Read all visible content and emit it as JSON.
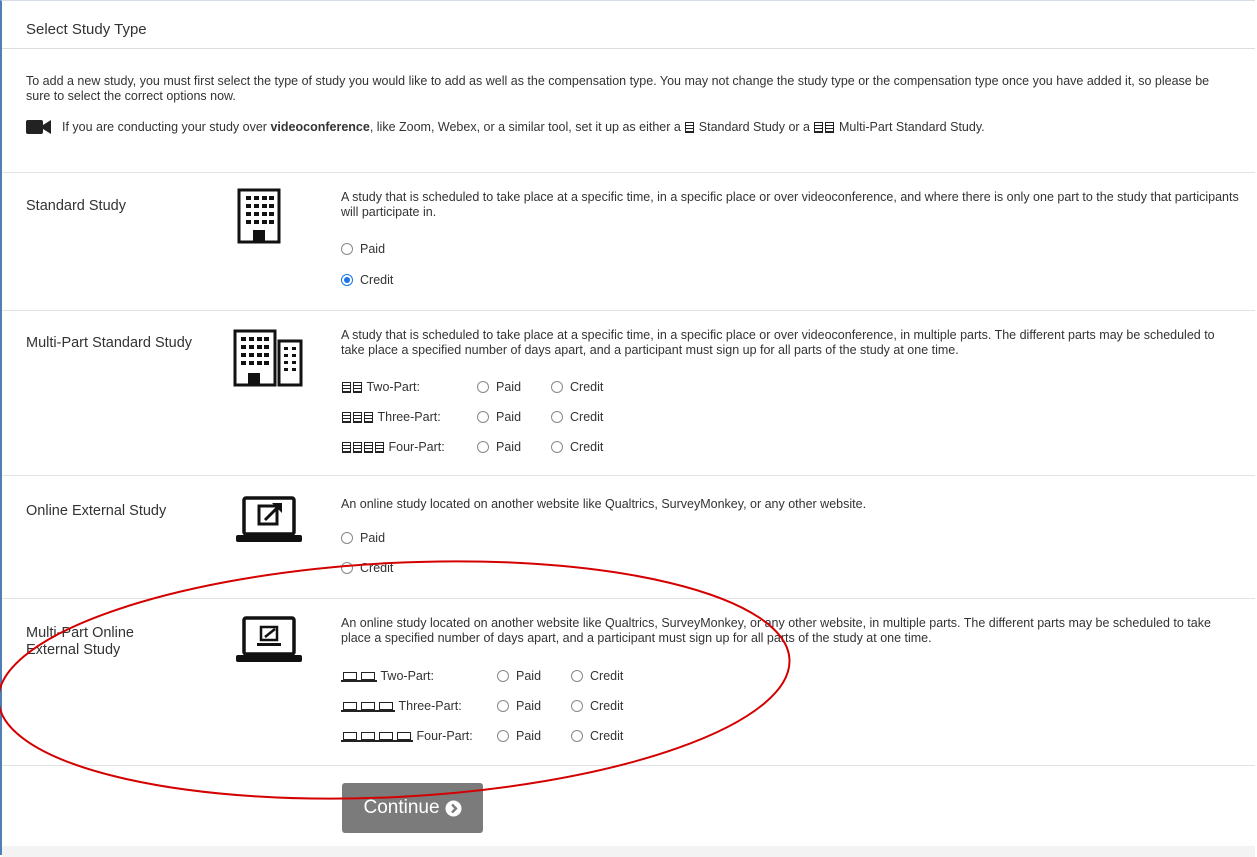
{
  "panel": {
    "title": "Select Study Type",
    "intro": "To add a new study, you must first select the type of study you would like to add as well as the compensation type. You may not change the study type or the compensation type once you have added it, so please be sure to select the correct options now.",
    "video_prefix": "If you are conducting your study over",
    "video_bold": "videoconference",
    "video_mid": ", like Zoom, Webex, or a similar tool, set it up as either a",
    "video_standard": "Standard Study or a",
    "video_multi": "Multi-Part Standard Study."
  },
  "studies": [
    {
      "name": "Standard Study",
      "icon": "building-icon",
      "description": "A study that is scheduled to take place at a specific time, in a specific place or over videoconference, and where there is only one part to the study that participants will participate in.",
      "paid_label": "Paid",
      "credit_label": "Credit",
      "selected": "Credit"
    },
    {
      "name": "Multi-Part Standard Study",
      "icon": "buildings-icon",
      "description": "A study that is scheduled to take place at a specific time, in a specific place or over videoconference, in multiple parts. The different parts may be scheduled to take place a specified number of days apart, and a participant must sign up for all parts of the study at one time.",
      "parts": [
        {
          "label": "Two-Part:",
          "paid": "Paid",
          "credit": "Credit"
        },
        {
          "label": "Three-Part:",
          "paid": "Paid",
          "credit": "Credit"
        },
        {
          "label": "Four-Part:",
          "paid": "Paid",
          "credit": "Credit"
        }
      ]
    },
    {
      "name": "Online External Study",
      "icon": "laptop-external-link-icon",
      "description": "An online study located on another website like Qualtrics, SurveyMonkey, or any other website.",
      "paid_label": "Paid",
      "credit_label": "Credit"
    },
    {
      "name": "Multi-Part Online External Study",
      "icon": "laptop-multi-icon",
      "description": "An online study located on another website like Qualtrics, SurveyMonkey, or any other website, in multiple parts. The different parts may be scheduled to take place a specified number of days apart, and a participant must sign up for all parts of the study at one time.",
      "parts": [
        {
          "label": "Two-Part:",
          "paid": "Paid",
          "credit": "Credit"
        },
        {
          "label": "Three-Part:",
          "paid": "Paid",
          "credit": "Credit"
        },
        {
          "label": "Four-Part:",
          "paid": "Paid",
          "credit": "Credit"
        }
      ]
    }
  ],
  "continue_label": "Continue",
  "colors": {
    "accent": "#1a73e8",
    "button": "#7b7b7b",
    "annotation": "#d40000"
  }
}
